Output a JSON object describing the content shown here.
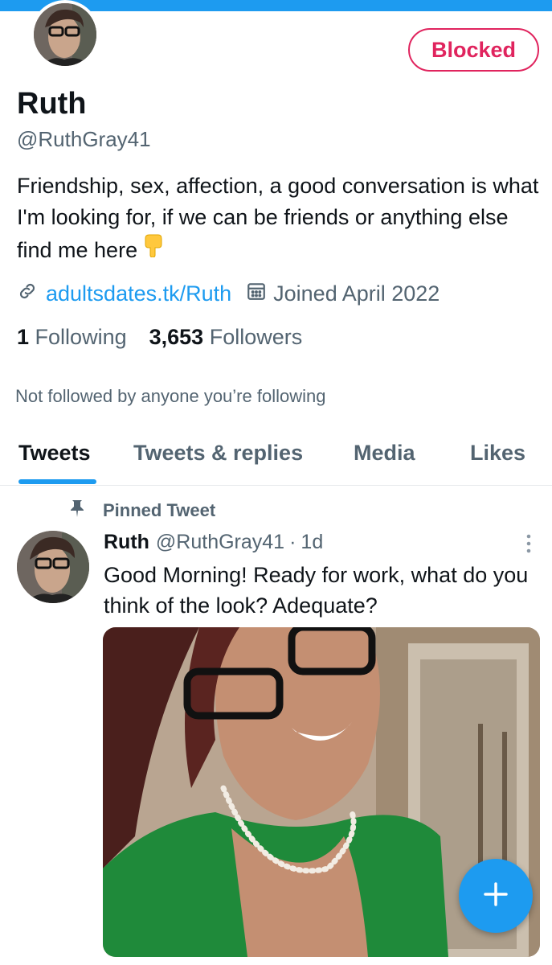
{
  "profile": {
    "name": "Ruth",
    "handle": "@RuthGray41",
    "bio": "Friendship, sex, affection, a good conversation is what I'm looking for, if we can be friends or anything else find me here",
    "link": "adultsdates.tk/Ruth",
    "joined": "Joined April 2022",
    "following_count": "1",
    "following_label": "Following",
    "followers_count": "3,653",
    "followers_label": "Followers",
    "not_followed": "Not followed by anyone you’re following",
    "status_button": "Blocked"
  },
  "tabs": [
    {
      "label": "Tweets",
      "active": true
    },
    {
      "label": "Tweets & replies",
      "active": false
    },
    {
      "label": "Media",
      "active": false
    },
    {
      "label": "Likes",
      "active": false
    }
  ],
  "pinned_tweet": {
    "label": "Pinned Tweet",
    "name": "Ruth",
    "handle": "@RuthGray41",
    "time": "1d",
    "text": "Good Morning!  Ready for work, what do you think of the look?  Adequate?"
  },
  "colors": {
    "accent": "#1d9bf0",
    "blocked": "#e0245e",
    "secondary_text": "#536471"
  },
  "icons": [
    "link-icon",
    "calendar-icon",
    "pin-icon",
    "more-icon",
    "plus-icon",
    "point-down-emoji"
  ]
}
